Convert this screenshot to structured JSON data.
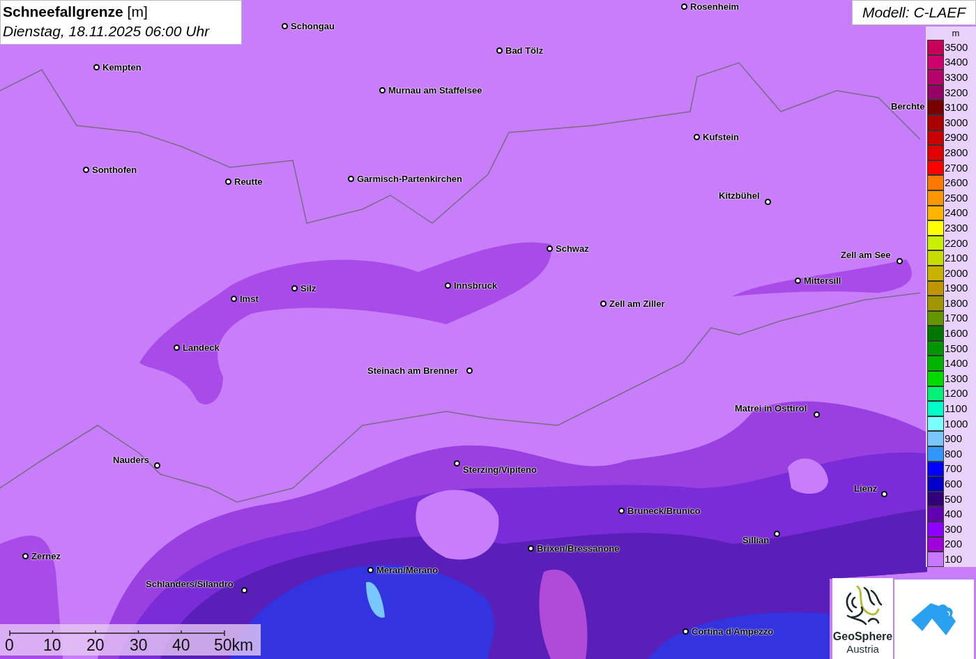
{
  "title": {
    "variable": "Schneefallgrenze",
    "unit": "[m]",
    "datetime": "Dienstag, 18.11.2025 06:00 Uhr"
  },
  "model": "Modell: C-LAEF",
  "cities": [
    {
      "label": "Rosenheim"
    },
    {
      "label": "Schongau"
    },
    {
      "label": "Kempten"
    },
    {
      "label": "Bad Tölz"
    },
    {
      "label": "Murnau am Staffelsee"
    },
    {
      "label": "Berchte"
    },
    {
      "label": "Kufstein"
    },
    {
      "label": "Sonthofen"
    },
    {
      "label": "Reutte"
    },
    {
      "label": "Garmisch-Partenkirchen"
    },
    {
      "label": "Kitzbühel"
    },
    {
      "label": "Schwaz"
    },
    {
      "label": "Zell am See"
    },
    {
      "label": "Mittersill"
    },
    {
      "label": "Silz"
    },
    {
      "label": "Innsbruck"
    },
    {
      "label": "Imst"
    },
    {
      "label": "Zell am Ziller"
    },
    {
      "label": "Landeck"
    },
    {
      "label": "Steinach am Brenner"
    },
    {
      "label": "Matrei in Osttirol"
    },
    {
      "label": "Nauders"
    },
    {
      "label": "Sterzing/Vipiteno"
    },
    {
      "label": "Lienz"
    },
    {
      "label": "Bruneck/Brunico"
    },
    {
      "label": "Sillian"
    },
    {
      "label": "Brixen/Bressanone"
    },
    {
      "label": "Zernez"
    },
    {
      "label": "Meran/Merano"
    },
    {
      "label": "Schlanders/Silandro"
    },
    {
      "label": "Cortina d'Ampezzo"
    }
  ],
  "legend": {
    "unit": "m",
    "items": [
      {
        "label": "3500",
        "color": "#c8005a"
      },
      {
        "label": "3400",
        "color": "#d0006e"
      },
      {
        "label": "3300",
        "color": "#b8006a"
      },
      {
        "label": "3200",
        "color": "#960064"
      },
      {
        "label": "3100",
        "color": "#780000"
      },
      {
        "label": "3000",
        "color": "#aa0000"
      },
      {
        "label": "2900",
        "color": "#c80000"
      },
      {
        "label": "2800",
        "color": "#e00000"
      },
      {
        "label": "2700",
        "color": "#ff0000"
      },
      {
        "label": "2600",
        "color": "#ff7800"
      },
      {
        "label": "2500",
        "color": "#ff9600"
      },
      {
        "label": "2400",
        "color": "#ffb400"
      },
      {
        "label": "2300",
        "color": "#ffff00"
      },
      {
        "label": "2200",
        "color": "#c8f000"
      },
      {
        "label": "2100",
        "color": "#c8dc00"
      },
      {
        "label": "2000",
        "color": "#c8b400"
      },
      {
        "label": "1900",
        "color": "#c09600"
      },
      {
        "label": "1800",
        "color": "#a09600"
      },
      {
        "label": "1700",
        "color": "#649600"
      },
      {
        "label": "1600",
        "color": "#007800"
      },
      {
        "label": "1500",
        "color": "#009600"
      },
      {
        "label": "1400",
        "color": "#00b400"
      },
      {
        "label": "1300",
        "color": "#00dc00"
      },
      {
        "label": "1200",
        "color": "#00f078"
      },
      {
        "label": "1100",
        "color": "#00ffc8"
      },
      {
        "label": "1000",
        "color": "#78ffff"
      },
      {
        "label": "900",
        "color": "#78c8ff"
      },
      {
        "label": "800",
        "color": "#3296ff"
      },
      {
        "label": "700",
        "color": "#0000ff"
      },
      {
        "label": "600",
        "color": "#0000c8"
      },
      {
        "label": "500",
        "color": "#320078"
      },
      {
        "label": "400",
        "color": "#6400b4"
      },
      {
        "label": "300",
        "color": "#8c00ff"
      },
      {
        "label": "200",
        "color": "#a000dc"
      },
      {
        "label": "100",
        "color": "#c878ff"
      }
    ]
  },
  "scale_bar": {
    "ticks": [
      "0",
      "10",
      "20",
      "30",
      "40",
      "50km"
    ]
  },
  "logos": [
    {
      "kind": "geosphere",
      "line1": "GeoSphere",
      "line2": "Austria"
    },
    {
      "kind": "cloud-mark"
    }
  ]
}
